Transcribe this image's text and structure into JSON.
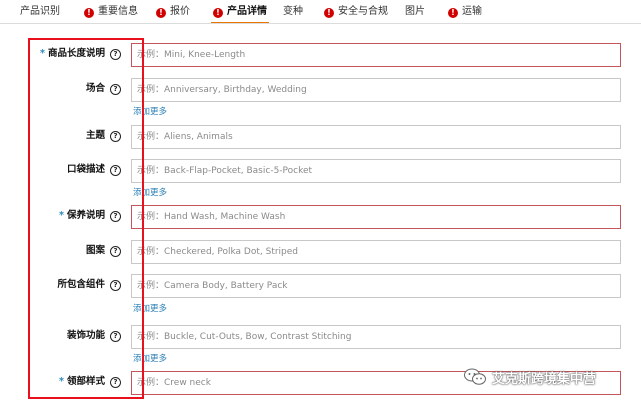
{
  "tabs": [
    {
      "label": "产品识别",
      "alert": false,
      "active": false
    },
    {
      "label": "重要信息",
      "alert": true,
      "active": false
    },
    {
      "label": "报价",
      "alert": true,
      "active": false
    },
    {
      "label": "产品详情",
      "alert": true,
      "active": true
    },
    {
      "label": "变种",
      "alert": false,
      "active": false
    },
    {
      "label": "安全与合规",
      "alert": true,
      "active": false
    },
    {
      "label": "图片",
      "alert": false,
      "active": false
    },
    {
      "label": "运输",
      "alert": true,
      "active": false
    }
  ],
  "alert_glyph": "!",
  "help_glyph": "?",
  "required_marker": "*",
  "fields": [
    {
      "label": "商品长度说明",
      "required": true,
      "placeholder": "示例：Mini, Knee-Length",
      "add_more": ""
    },
    {
      "label": "场合",
      "required": false,
      "placeholder": "示例：Anniversary, Birthday, Wedding",
      "add_more": "添加更多"
    },
    {
      "label": "主题",
      "required": false,
      "placeholder": "示例：Aliens, Animals",
      "add_more": ""
    },
    {
      "label": "口袋描述",
      "required": false,
      "placeholder": "示例：Back-Flap-Pocket, Basic-5-Pocket",
      "add_more": "添加更多"
    },
    {
      "label": "保养说明",
      "required": true,
      "placeholder": "示例：Hand Wash, Machine Wash",
      "add_more": ""
    },
    {
      "label": "图案",
      "required": false,
      "placeholder": "示例：Checkered, Polka Dot, Striped",
      "add_more": ""
    },
    {
      "label": "所包含组件",
      "required": false,
      "placeholder": "示例：Camera Body, Battery Pack",
      "add_more": "添加更多"
    },
    {
      "label": "装饰功能",
      "required": false,
      "placeholder": "示例：Buckle, Cut-Outs, Bow, Contrast Stitching",
      "add_more": "添加更多"
    },
    {
      "label": "领部样式",
      "required": true,
      "placeholder": "示例：Crew neck",
      "add_more": ""
    }
  ],
  "watermark": {
    "text": "艾克斯跨境集中营",
    "icon": "wechat-icon"
  },
  "colors": {
    "accent": "#e77600",
    "alert": "#d00000",
    "link": "#2b7fb6",
    "highlight": "#e8101c",
    "invalid_border": "#c4555c"
  }
}
